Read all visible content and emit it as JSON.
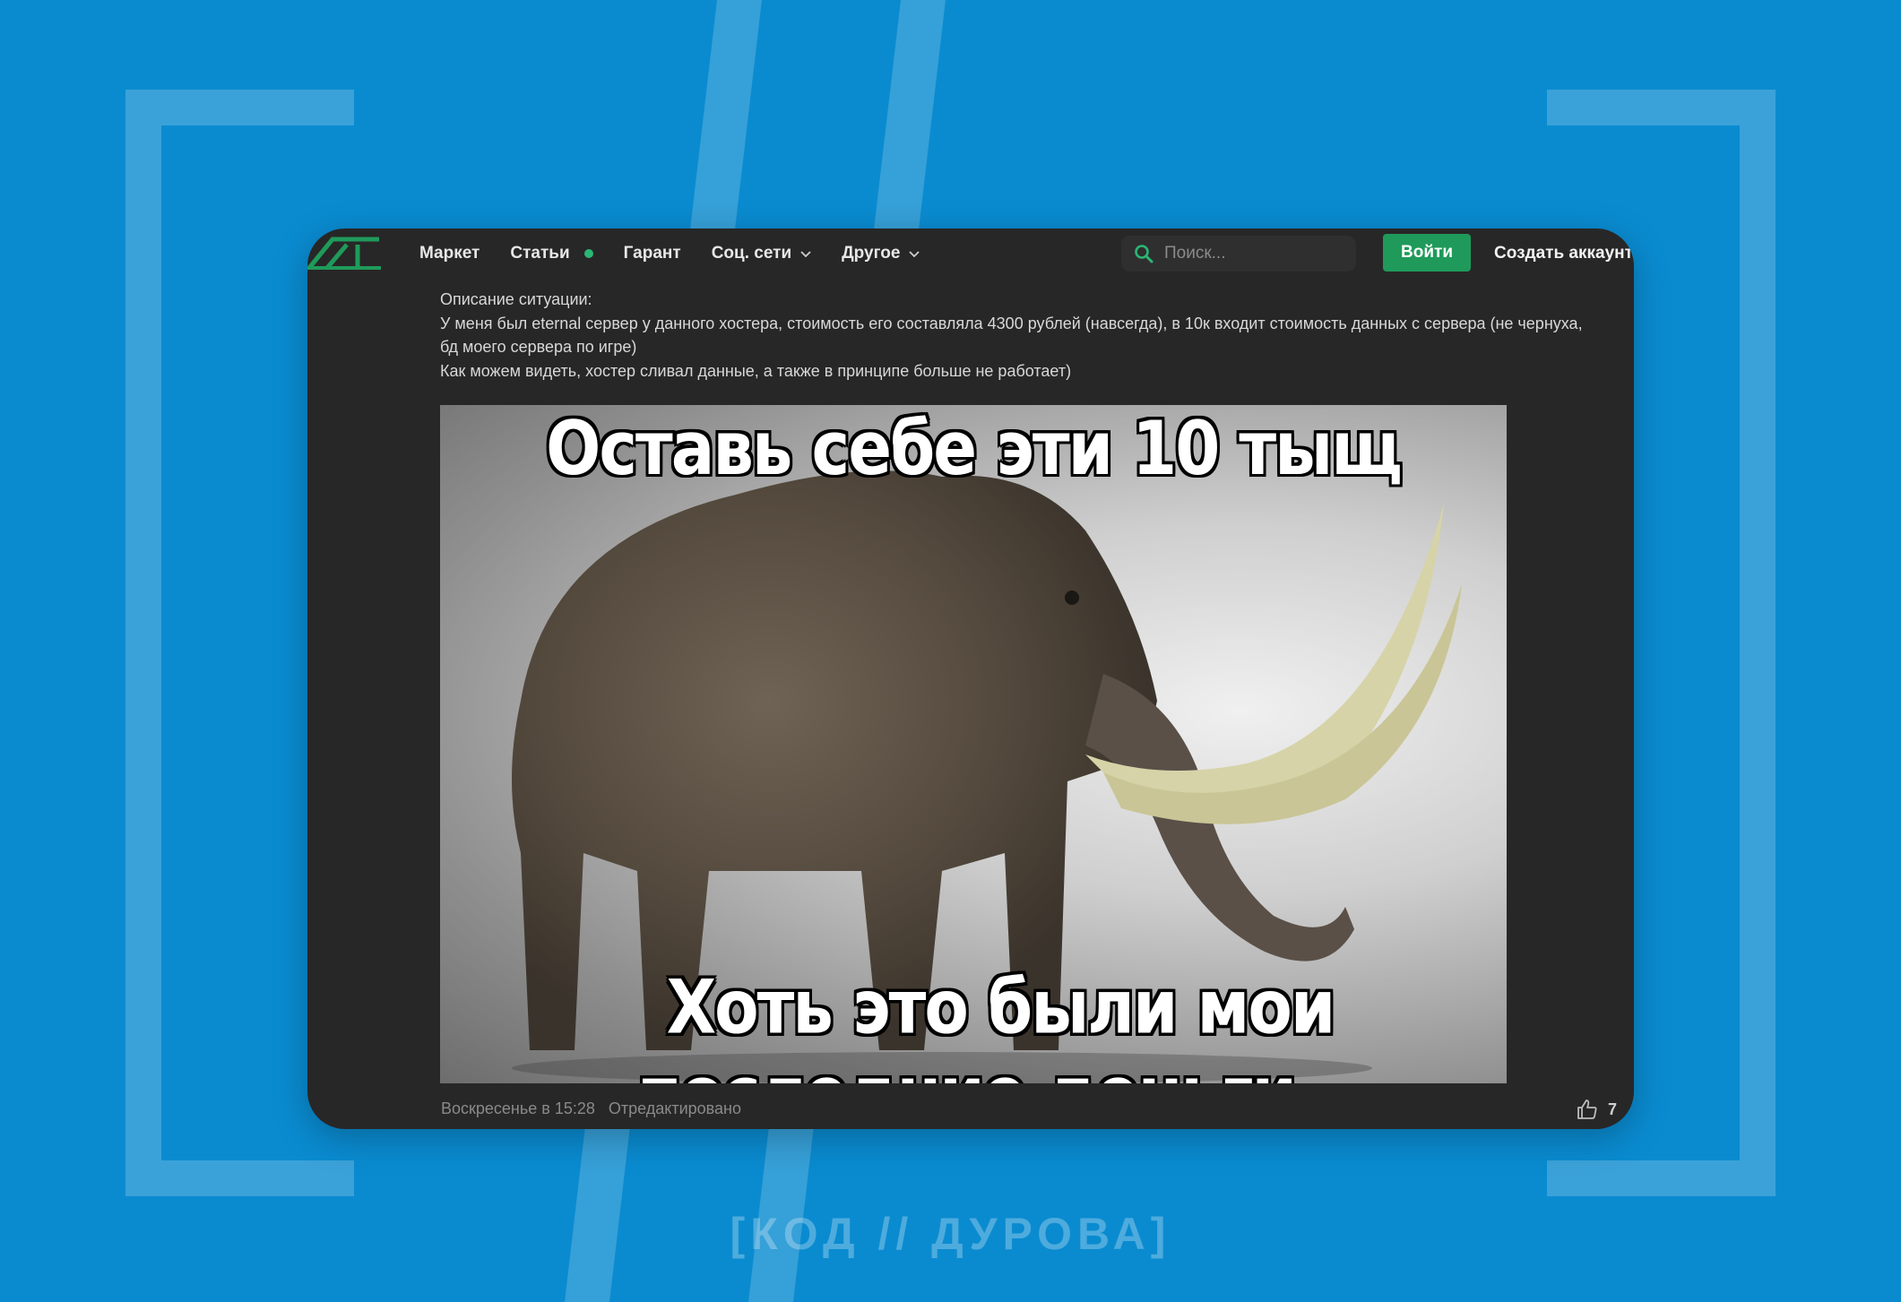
{
  "nav": {
    "items": [
      {
        "label": "Маркет"
      },
      {
        "label": "Статьи"
      },
      {
        "label": "Гарант"
      },
      {
        "label": "Соц. сети"
      },
      {
        "label": "Другое"
      }
    ],
    "search_placeholder": "Поиск...",
    "login_label": "Войти",
    "signup_label": "Создать аккаунт"
  },
  "post": {
    "lines": [
      "Описание ситуации:",
      "У меня был eternal сервер у данного хостера, стоимость его составляла 4300 рублей (навсегда), в 10к входит стоимость данных с сервера (не чернуха, бд моего сервера по игре)",
      "Как можем видеть, хостер сливал данные, а также в принципе больше не работает)"
    ],
    "meme_top": "Оставь себе эти 10 тыщ",
    "meme_bottom": "Хоть это были мои последние деньги...",
    "date": "Воскресенье в 15:28",
    "edited": "Отредактировано",
    "likes": "7"
  },
  "watermark": "[КОД // ДУРОВА]",
  "colors": {
    "background": "#0a8bd0",
    "panel": "#272727",
    "accent_green": "#1f9a5a",
    "dot_green": "#2bb673"
  }
}
